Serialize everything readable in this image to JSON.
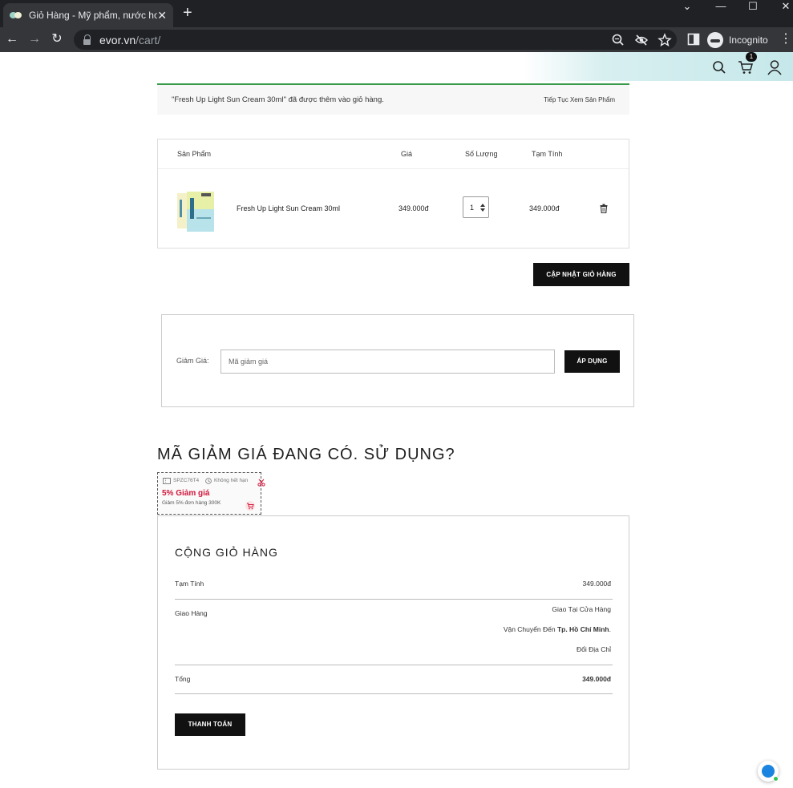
{
  "browser": {
    "tab_title": "Giỏ Hàng - Mỹ phẩm, nước hoa l",
    "url_host": "evor.vn",
    "url_path": "/cart/",
    "profile_label": "Incognito"
  },
  "header": {
    "cart_count": "1"
  },
  "notice": {
    "message": "\"Fresh Up Light Sun Cream 30ml\" đã được thêm vào giỏ hàng.",
    "continue_link": "Tiếp Tục Xem Sản Phẩm"
  },
  "cart_table": {
    "headers": [
      "Sản Phẩm",
      "Giá",
      "Số Lượng",
      "Tạm Tính"
    ],
    "rows": [
      {
        "name": "Fresh Up Light Sun Cream 30ml",
        "price": "349.000đ",
        "quantity": "1",
        "subtotal": "349.000đ"
      }
    ]
  },
  "update_button": "CẬP NHẬT GIỎ HÀNG",
  "coupon": {
    "label": "Giảm Giá:",
    "placeholder": "Mã giảm giá",
    "apply_button": "ÁP DỤNG"
  },
  "available_coupons_title": "MÃ GIẢM GIÁ ĐANG CÓ. SỬ DỤNG?",
  "voucher": {
    "code": "SPZC76T4",
    "expiry": "Không hết hạn",
    "title": "5% Giảm giá",
    "description": "Giảm 5% đơn hàng 300K"
  },
  "totals": {
    "title": "CỘNG GIỎ HÀNG",
    "subtotal_label": "Tạm Tính",
    "subtotal_value": "349.000đ",
    "shipping_label": "Giao Hàng",
    "shipping_method": "Giao Tại Cửa Hàng",
    "shipping_to_prefix": "Vận Chuyển Đến",
    "shipping_to_city": "Tp. Hồ Chí Minh",
    "change_address": "Đổi Địa Chỉ",
    "total_label": "Tổng",
    "total_value": "349.000đ",
    "checkout_button": "THANH TOÁN"
  }
}
